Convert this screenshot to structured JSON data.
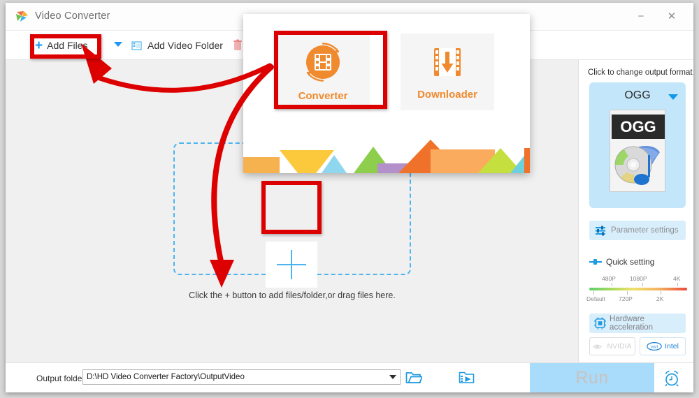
{
  "window": {
    "title": "Video Converter",
    "logo_icon": "app-logo-icon",
    "minimize_label": "−",
    "close_label": "✕"
  },
  "toolbar": {
    "add_files_label": "Add Files",
    "add_files_plus": "+",
    "dropdown_icon": "chevron-down-icon",
    "add_video_folder_label": "Add Video Folder",
    "add_video_folder_icon": "folder-video-icon",
    "clear_icon": "trash-icon"
  },
  "workspace": {
    "dropzone_hint": "Click the + button to add files/folder,or drag files here.",
    "plus_icon": "plus-icon"
  },
  "sidebar": {
    "format_label": "Click to change output format:",
    "format_name": "OGG",
    "format_thumb_text": "OGG",
    "format_caret_icon": "chevron-down-icon",
    "parameter_settings_label": "Parameter settings",
    "parameter_settings_icon": "sliders-icon",
    "quick_setting_label": "Quick setting",
    "quick_setting_icon": "slider-handle-icon",
    "quality_top_labels": [
      "480P",
      "1080P",
      "4K"
    ],
    "quality_bottom_labels": [
      "Default",
      "720P",
      "2K"
    ],
    "hardware_acceleration_label": "Hardware acceleration",
    "hardware_acceleration_icon": "cpu-chip-icon",
    "gpu_nvidia_label": "NVIDIA",
    "gpu_nvidia_icon": "nvidia-eye-icon",
    "gpu_intel_label": "Intel",
    "gpu_intel_icon": "intel-badge-icon"
  },
  "bottom": {
    "output_folder_label": "Output folder:",
    "output_folder_path": "D:\\HD Video Converter Factory\\OutputVideo",
    "output_caret_icon": "chevron-down-icon",
    "open_folder_icon": "open-folder-icon",
    "merge_icon": "merge-video-icon",
    "run_label": "Run",
    "alarm_icon": "alarm-clock-icon"
  },
  "popup": {
    "converter_label": "Converter",
    "converter_icon": "film-reel-convert-icon",
    "downloader_label": "Downloader",
    "downloader_icon": "film-download-icon"
  },
  "annotations": {
    "highlight_color": "#dd0000",
    "arrow_color": "#dd0000",
    "boxes": [
      "add-files-button",
      "converter-card",
      "plus-drop-target"
    ],
    "arrows": [
      "converter-to-add-files",
      "converter-to-plus"
    ]
  },
  "colors": {
    "accent_blue": "#2196f3",
    "orange": "#f08a2e",
    "sidebar_card": "#c4e6fb",
    "run_button": "#a9dcfb"
  }
}
